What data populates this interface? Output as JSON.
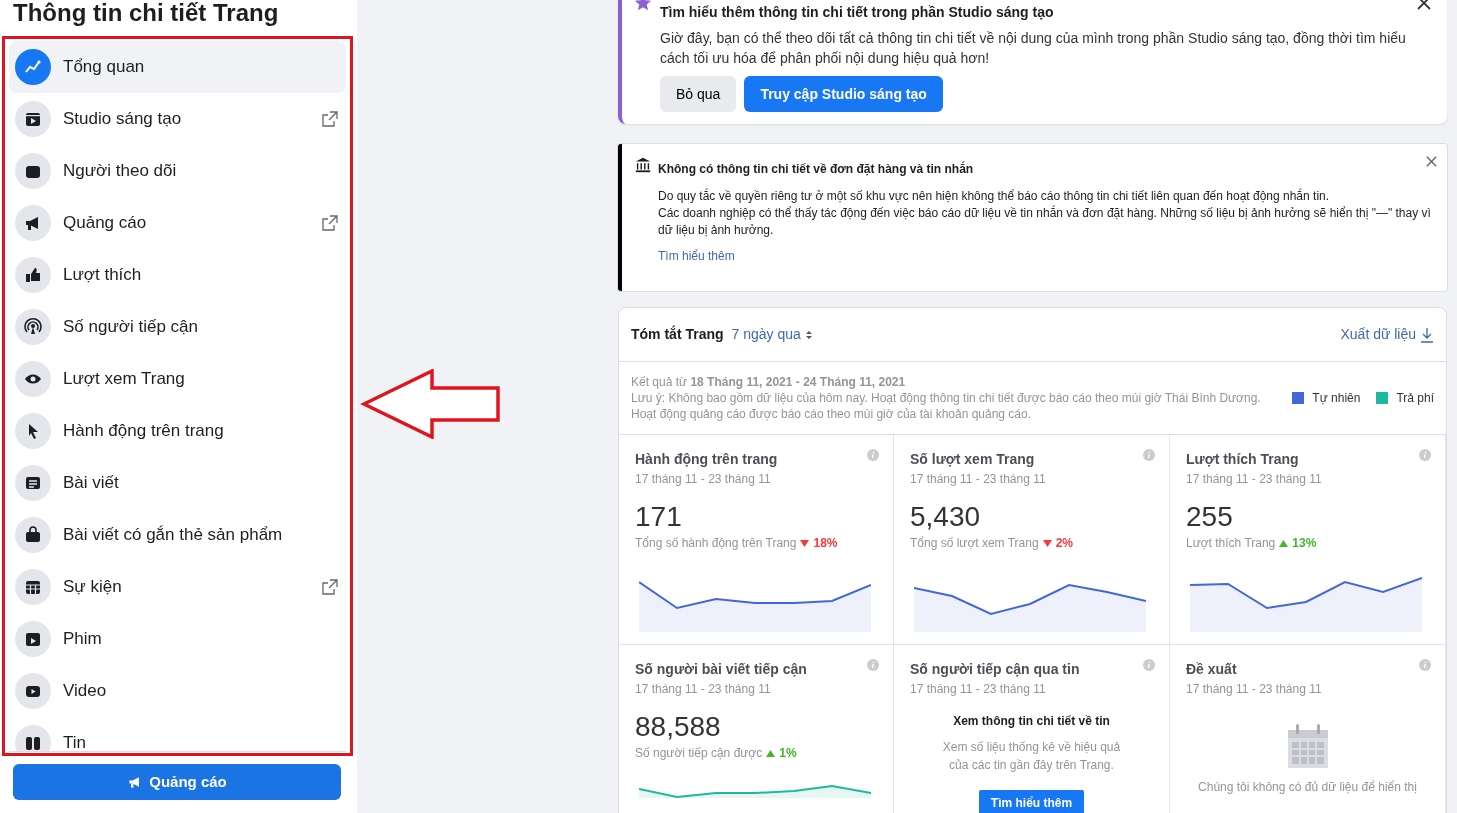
{
  "sidebar": {
    "title": "Thông tin chi tiết Trang",
    "items": [
      {
        "label": "Tổng quan",
        "selected": true,
        "external": false
      },
      {
        "label": "Studio sáng tạo",
        "selected": false,
        "external": true
      },
      {
        "label": "Người theo dõi",
        "selected": false,
        "external": false
      },
      {
        "label": "Quảng cáo",
        "selected": false,
        "external": true
      },
      {
        "label": "Lượt thích",
        "selected": false,
        "external": false
      },
      {
        "label": "Số người tiếp cận",
        "selected": false,
        "external": false
      },
      {
        "label": "Lượt xem Trang",
        "selected": false,
        "external": false
      },
      {
        "label": "Hành động trên trang",
        "selected": false,
        "external": false
      },
      {
        "label": "Bài viết",
        "selected": false,
        "external": false
      },
      {
        "label": "Bài viết có gắn thẻ sản phẩm",
        "selected": false,
        "external": false
      },
      {
        "label": "Sự kiện",
        "selected": false,
        "external": true
      },
      {
        "label": "Phim",
        "selected": false,
        "external": false
      },
      {
        "label": "Video",
        "selected": false,
        "external": false
      },
      {
        "label": "Tin",
        "selected": false,
        "external": false
      }
    ],
    "button": "Quảng cáo"
  },
  "studio_banner": {
    "title": "Tìm hiểu thêm thông tin chi tiết trong phần Studio sáng tạo",
    "text": "Giờ đây, bạn có thể theo dõi tất cả thông tin chi tiết về nội dung của mình trong phần Studio sáng tạo, đồng thời tìm hiểu cách tối ưu hóa để phân phối nội dung hiệu quả hơn!",
    "buttons": [
      {
        "label": "Bỏ qua",
        "kind": "secondary"
      },
      {
        "label": "Truy cập Studio sáng tạo",
        "kind": "primary"
      }
    ]
  },
  "privacy_notice": {
    "title": "Không có thông tin chi tiết về đơn đặt hàng và tin nhắn",
    "lines": [
      "Do quy tắc về quyền riêng tư ở một số khu vực nên hiện không thể báo cáo thông tin chi tiết liên quan đến hoạt động nhắn tin.",
      "Các doanh nghiệp có thể thấy tác động đến việc báo cáo dữ liệu về tin nhắn và đơn đặt hàng. Những số liệu bị ảnh hưởng sẽ hiển thị \"—\" thay vì dữ liệu bị ảnh hưởng."
    ],
    "link": "Tìm hiểu thêm"
  },
  "summary": {
    "title": "Tóm tắt Trang",
    "period": "7 ngày qua",
    "export": "Xuất dữ liệu",
    "range": "Kết quả từ **18 Tháng 11, 2021 - 24 Tháng 11, 2021**",
    "notes": [
      "Lưu ý: Không bao gồm dữ liệu của hôm nay. Hoạt động thông tin chi tiết được báo cáo theo múi giờ Thái Bình Dương.",
      "Hoạt động quảng cáo được báo cáo theo múi giờ của tài khoản quảng cáo."
    ],
    "legend": [
      {
        "label": "Tự nhiên",
        "color": "#4267d6"
      },
      {
        "label": "Trả phí",
        "color": "#1db99c"
      }
    ],
    "cards": [
      {
        "kind": "metric",
        "title": "Hành động trên trang",
        "dates": "17 tháng 11 - 23 tháng 11",
        "value": "171",
        "caption": "Tổng số hành động trên Trang",
        "change": "18%",
        "increase": false
      },
      {
        "kind": "metric",
        "title": "Số lượt xem Trang",
        "dates": "17 tháng 11 - 23 tháng 11",
        "value": "5,430",
        "caption": "Tổng số lượt xem Trang",
        "change": "2%",
        "increase": false
      },
      {
        "kind": "metric",
        "title": "Lượt thích Trang",
        "dates": "17 tháng 11 - 23 tháng 11",
        "value": "255",
        "caption": "Lượt thích Trang",
        "change": "13%",
        "increase": true
      },
      {
        "kind": "metric",
        "title": "Số người bài viết tiếp cận",
        "dates": "17 tháng 11 - 23 tháng 11",
        "value": "88,588",
        "caption": "Số người tiếp cận được",
        "change": "1%",
        "increase": true
      },
      {
        "kind": "story",
        "title": "Số người tiếp cận qua tin",
        "dates": "17 tháng 11 - 23 tháng 11",
        "heading": "Xem thông tin chi tiết về tin",
        "text": "Xem số liệu thống kê về hiệu quả của các tin gần đây trên Trang.",
        "button": "Tìm hiểu thêm"
      },
      {
        "kind": "empty",
        "title": "Đề xuất",
        "dates": "17 tháng 11 - 23 tháng 11",
        "message": "Chúng tôi không có đủ dữ liệu để hiển thị"
      }
    ]
  }
}
